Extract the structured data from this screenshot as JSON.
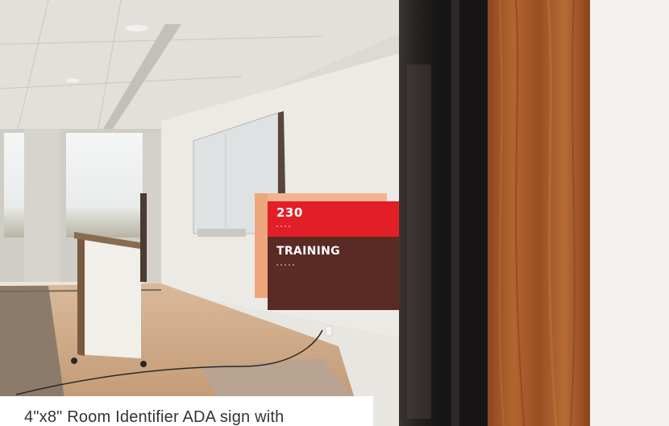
{
  "sign": {
    "room_number": "230",
    "room_name": "TRAINING"
  },
  "caption": {
    "text": "4\"x8\" Room Identifier ADA sign with"
  },
  "colors": {
    "sign_red": "#e21f26",
    "sign_brown": "#5a2a25",
    "sign_backplate": "#f1b48f",
    "wood_door_frame": "#a4582a"
  }
}
